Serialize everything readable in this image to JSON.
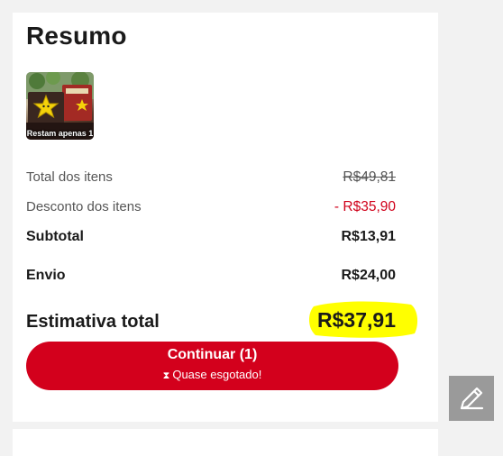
{
  "summary": {
    "title": "Resumo",
    "item_badge": "Restam apenas 1",
    "lines": [
      {
        "label": "Total dos itens",
        "value": "R$49,81"
      },
      {
        "label": "Desconto dos itens",
        "value": "- R$35,90"
      },
      {
        "label": "Subtotal",
        "value": "R$13,91"
      },
      {
        "label": "Envio",
        "value": "R$24,00"
      }
    ],
    "total": {
      "label": "Estimativa total",
      "value": "R$37,91"
    }
  },
  "checkout_button": {
    "label": "Continuar (1)",
    "note": "Quase esgotado!",
    "note_icon": "hourglass-icon"
  },
  "edit_button": {
    "icon": "pencil-icon"
  },
  "colors": {
    "accent_red": "#d3001c",
    "discount_red": "#d0021b",
    "highlight": "#ffff00"
  }
}
